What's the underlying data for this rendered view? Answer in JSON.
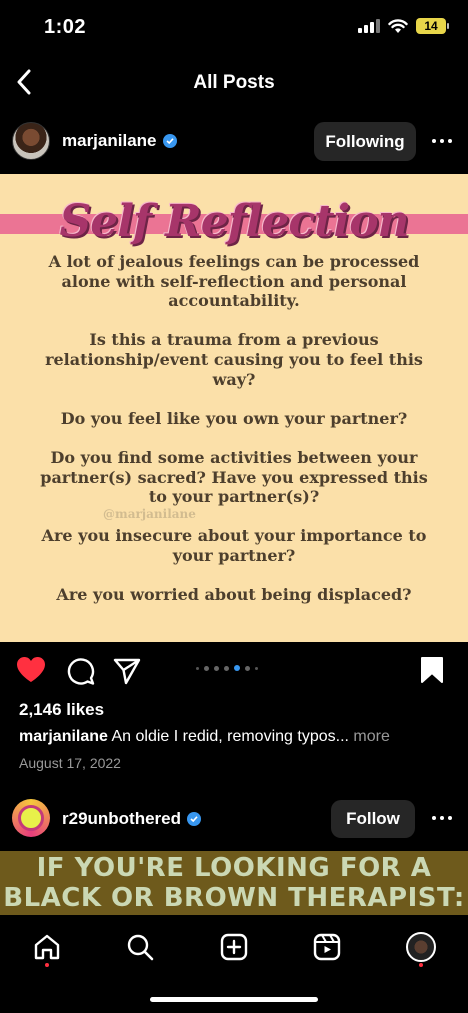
{
  "status_bar": {
    "time": "1:02",
    "battery": "14"
  },
  "header": {
    "title": "All Posts"
  },
  "post": {
    "username": "marjanilane",
    "follow_label": "Following",
    "image": {
      "heading": "Self Reflection",
      "paragraphs": [
        "A lot of jealous feelings can be processed alone with self-reflection and personal accountability.",
        "Is this a trauma from a previous relationship/event causing you to feel this way?",
        "Do you feel like you own your partner?",
        "Do you find some activities between your partner(s) sacred? Have you expressed this to your partner(s)?",
        "Are you insecure about your importance to your partner?",
        "Are you worried about being displaced?"
      ],
      "watermark": "@marjanilane"
    },
    "carousel": {
      "total": 7,
      "active": 5
    },
    "likes": "2,146 likes",
    "caption": {
      "user": "marjanilane",
      "text": "An oldie I redid, removing typos...",
      "more": "more"
    },
    "date": "August 17, 2022"
  },
  "next_post": {
    "username": "r29unbothered",
    "follow_label": "Follow",
    "banner_lines": [
      "IF YOU'RE LOOKING FOR A",
      "BLACK OR BROWN THERAPIST:"
    ]
  },
  "tab_bar": {
    "icons": [
      "home-icon",
      "search-icon",
      "create-icon",
      "reels-icon",
      "profile-avatar"
    ]
  },
  "colors": {
    "accent_blue": "#3897f0",
    "like_red": "#ff3040",
    "post_bg": "#fbe0a9",
    "band_pink": "#eb7494",
    "heading_magenta": "#a7356a"
  }
}
